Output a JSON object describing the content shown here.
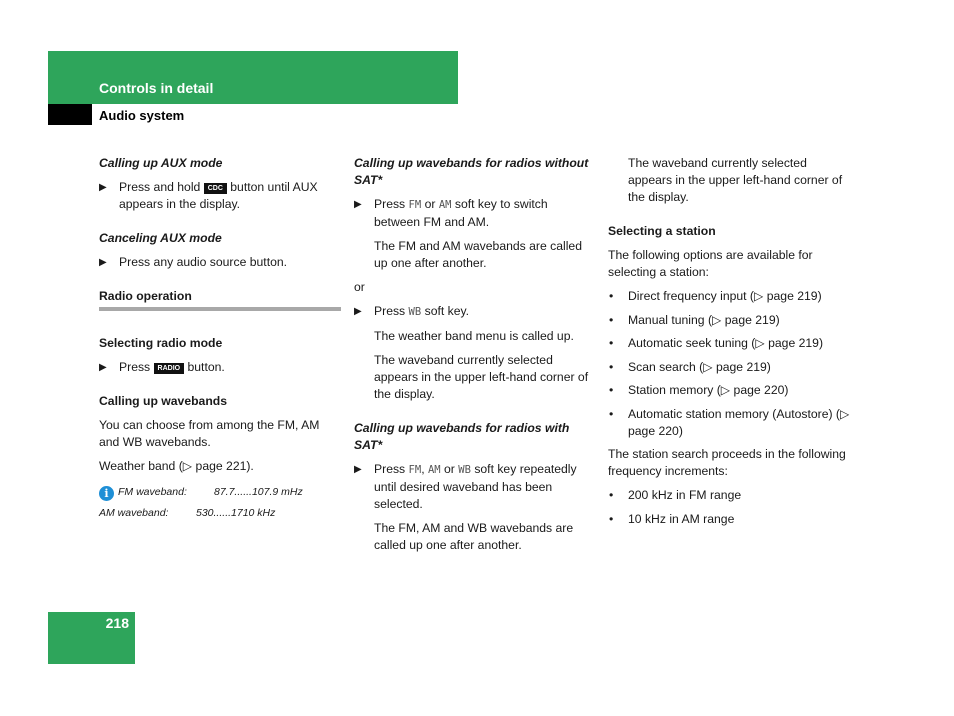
{
  "header": {
    "section": "Controls in detail",
    "subsection": "Audio system",
    "page_number": "218",
    "accent_color": "#2ea55b"
  },
  "col1": {
    "aux_heading": "Calling up AUX mode",
    "aux_step_pre": "Press and hold",
    "aux_key": "CDC",
    "aux_step_post": "button until AUX appears in the display.",
    "cancel_heading": "Canceling AUX mode",
    "cancel_step": "Press any audio source button.",
    "radio_heading": "Radio operation",
    "select_mode_heading": "Selecting radio mode",
    "select_step_pre": "Press",
    "radio_key": "RADIO",
    "select_step_post": "button.",
    "wavebands_heading": "Calling up wavebands",
    "wavebands_text": "You can choose from among the FM, AM and WB wavebands.",
    "weather_text": "Weather band (▷ page 221).",
    "info_icon": "info-icon",
    "fm_label": "FM waveband:",
    "fm_range": "87.7......107.9 mHz",
    "am_label": "AM waveband:",
    "am_range": "530......1710 kHz"
  },
  "col2": {
    "nosat_heading": "Calling up wavebands for radios without SAT*",
    "nosat_press": "Press",
    "nosat_fm": "FM",
    "nosat_or": "or",
    "nosat_am": "AM",
    "nosat_rest": "soft key to switch between FM and AM.",
    "nosat_result": "The FM and AM wavebands are called up one after another.",
    "or": "or",
    "wb_press": "Press",
    "wb_key": "WB",
    "wb_rest": "soft key.",
    "wb_result": "The weather band menu is called up.",
    "wb_result2": "The waveband currently selected appears in the upper left-hand corner of the display.",
    "sat_heading": "Calling up wavebands for radios with SAT*",
    "sat_press": "Press",
    "sat_fm": "FM",
    "sat_comma": ",",
    "sat_am": "AM",
    "sat_or": "or",
    "sat_wb": "WB",
    "sat_rest": "soft key repeatedly until desired waveband has been selected.",
    "sat_result": "The FM, AM and WB wavebands are called up one after another."
  },
  "col3": {
    "cont_text": "The waveband currently selected appears in the upper left-hand corner of the display.",
    "station_heading": "Selecting a station",
    "station_intro": "The following options are available for selecting a station:",
    "options": [
      "Direct frequency input (▷ page 219)",
      "Manual tuning (▷ page 219)",
      "Automatic seek tuning (▷ page 219)",
      "Scan search (▷ page 219)",
      "Station memory (▷ page 220)",
      "Automatic station memory (Autostore) (▷ page 220)"
    ],
    "increments_intro": "The station search proceeds in the following frequency increments:",
    "increments": [
      "200 kHz in FM range",
      "10 kHz in AM range"
    ]
  },
  "glyphs": {
    "arrow": "▶",
    "bullet": "•"
  }
}
